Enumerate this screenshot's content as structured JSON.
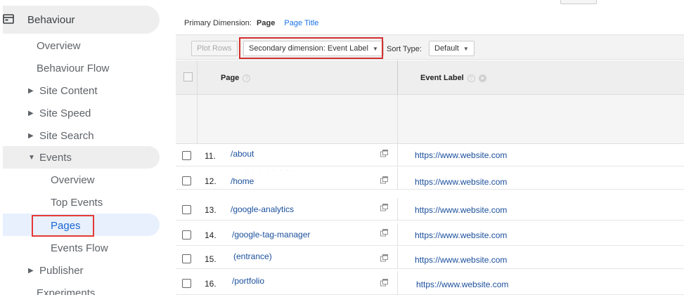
{
  "sidebar": {
    "section_label": "Behaviour",
    "items": [
      {
        "label": "Overview"
      },
      {
        "label": "Behaviour Flow"
      },
      {
        "label": "Site Content",
        "caret": "▶"
      },
      {
        "label": "Site Speed",
        "caret": "▶"
      },
      {
        "label": "Site Search",
        "caret": "▶"
      },
      {
        "label": "Events",
        "caret": "▼"
      },
      {
        "label": "Overview"
      },
      {
        "label": "Top Events"
      },
      {
        "label": "Pages"
      },
      {
        "label": "Events Flow"
      },
      {
        "label": "Publisher",
        "caret": "▶"
      },
      {
        "label": "Experiments"
      }
    ]
  },
  "primary_dimension": {
    "label": "Primary Dimension:",
    "selected": "Page",
    "alt": "Page Title"
  },
  "toolbar": {
    "plot_rows": "Plot Rows",
    "secondary_dimension": "Secondary dimension: Event Label",
    "sort_type_label": "Sort Type:",
    "sort_type_value": "Default"
  },
  "table": {
    "headers": {
      "page": "Page",
      "event_label": "Event Label"
    },
    "rows": [
      {
        "num": "11.",
        "page": "/about",
        "event_label": "https://www.website.com"
      },
      {
        "num": "12.",
        "page": "/home",
        "event_label": "https://www.website.com"
      },
      {
        "num": "13.",
        "page": "/google-analytics",
        "event_label": "https://www.website.com"
      },
      {
        "num": "14.",
        "page": "/google-tag-manager",
        "event_label": "https://www.website.com"
      },
      {
        "num": "15.",
        "page": "(entrance)",
        "event_label": "https://www.website.com"
      },
      {
        "num": "16.",
        "page": "/portfolio",
        "event_label": "https://www.website.com"
      }
    ]
  },
  "colors": {
    "accent": "#1a73e8",
    "highlight_box": "#d32f2f",
    "link": "#1a4f9c"
  }
}
